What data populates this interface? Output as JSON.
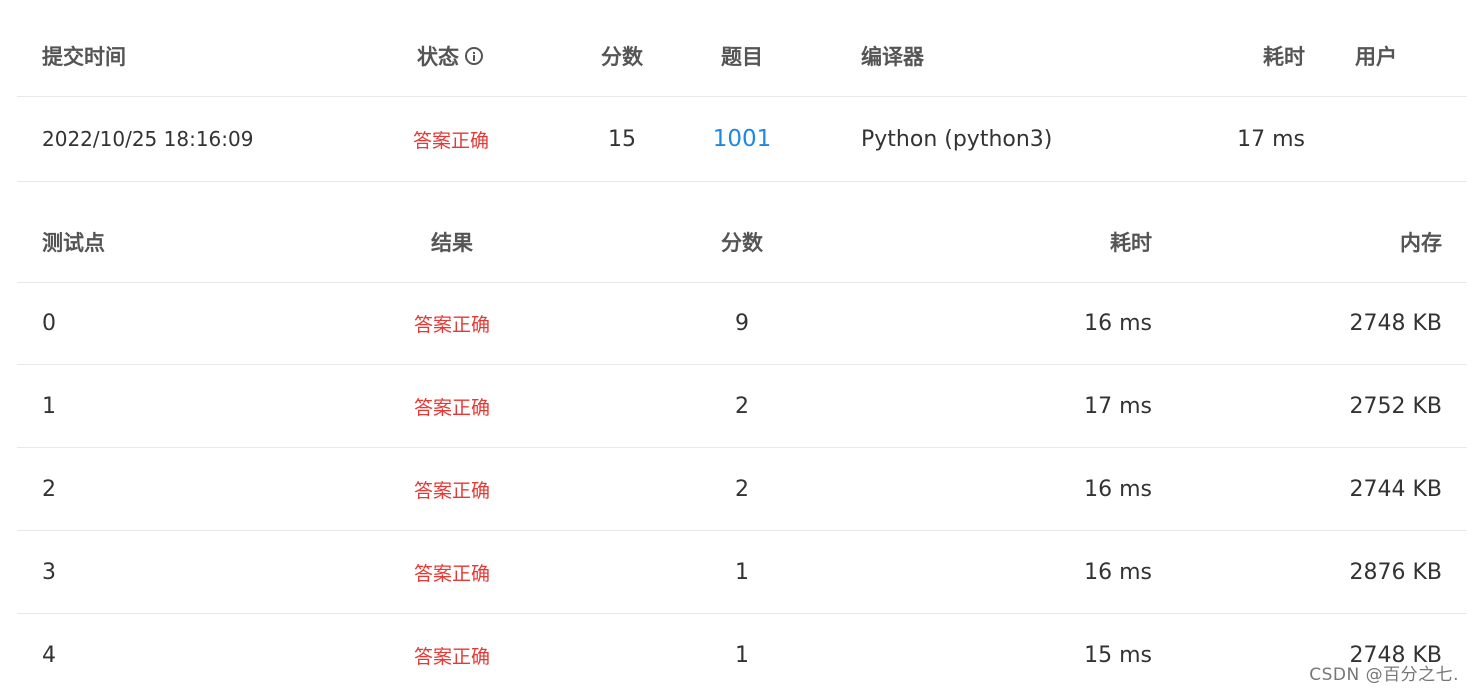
{
  "submission": {
    "headers": {
      "submit_time": "提交时间",
      "status": "状态",
      "score": "分数",
      "problem": "题目",
      "compiler": "编译器",
      "time_cost": "耗时",
      "user": "用户"
    },
    "row": {
      "submit_time": "2022/10/25 18:16:09",
      "status": "答案正确",
      "score": "15",
      "problem": "1001",
      "compiler": "Python (python3)",
      "time_cost": "17 ms",
      "user": ""
    }
  },
  "testcases": {
    "headers": {
      "point": "测试点",
      "result": "结果",
      "score": "分数",
      "time_cost": "耗时",
      "memory": "内存"
    },
    "rows": [
      {
        "point": "0",
        "result": "答案正确",
        "score": "9",
        "time_cost": "16 ms",
        "memory": "2748 KB"
      },
      {
        "point": "1",
        "result": "答案正确",
        "score": "2",
        "time_cost": "17 ms",
        "memory": "2752 KB"
      },
      {
        "point": "2",
        "result": "答案正确",
        "score": "2",
        "time_cost": "16 ms",
        "memory": "2744 KB"
      },
      {
        "point": "3",
        "result": "答案正确",
        "score": "1",
        "time_cost": "16 ms",
        "memory": "2876 KB"
      },
      {
        "point": "4",
        "result": "答案正确",
        "score": "1",
        "time_cost": "15 ms",
        "memory": "2748 KB"
      }
    ]
  },
  "watermark": "CSDN @百分之七.",
  "icons": {
    "status_info": "info-circle-icon"
  },
  "colors": {
    "status_ok": "#e53935",
    "link": "#1e88e5",
    "divider": "#e8e8e8"
  }
}
